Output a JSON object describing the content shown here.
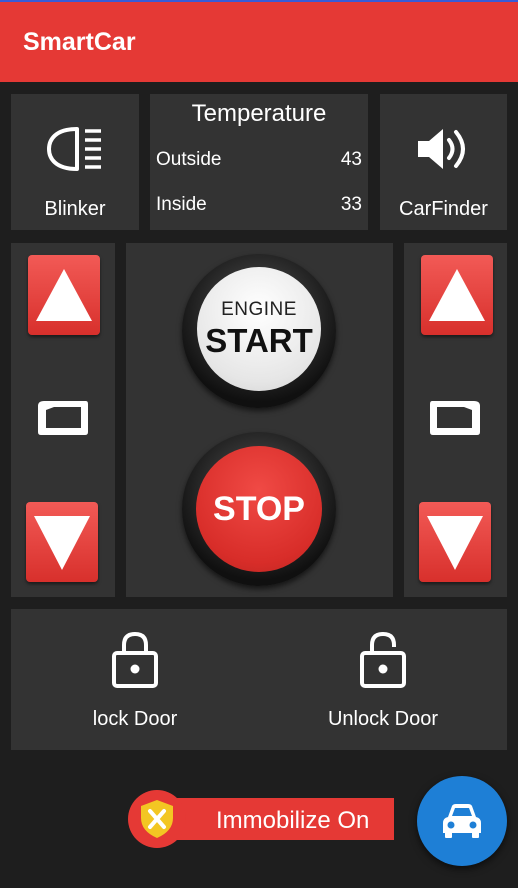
{
  "app": {
    "title": "SmartCar",
    "accent": "#e53935",
    "fab_color": "#1e7fd6"
  },
  "tiles": {
    "blinker": {
      "label": "Blinker",
      "icon": "headlight-icon"
    },
    "carfinder": {
      "label": "CarFinder",
      "icon": "speaker-icon"
    }
  },
  "temperature": {
    "title": "Temperature",
    "outside_label": "Outside",
    "outside_value": "43",
    "inside_label": "Inside",
    "inside_value": "33"
  },
  "windows": {
    "left": {
      "up_icon": "arrow-up-icon",
      "window_icon": "window-icon",
      "down_icon": "arrow-down-icon"
    },
    "right": {
      "up_icon": "arrow-up-icon",
      "window_icon": "window-icon",
      "down_icon": "arrow-down-icon"
    }
  },
  "engine": {
    "start_line1": "ENGINE",
    "start_line2": "START",
    "stop_label": "STOP"
  },
  "doors": {
    "lock_label": "lock Door",
    "unlock_label": "Unlock Door"
  },
  "immobilize": {
    "label": "Immobilize On",
    "icon": "shield-x-icon"
  },
  "fab": {
    "icon": "car-icon"
  }
}
